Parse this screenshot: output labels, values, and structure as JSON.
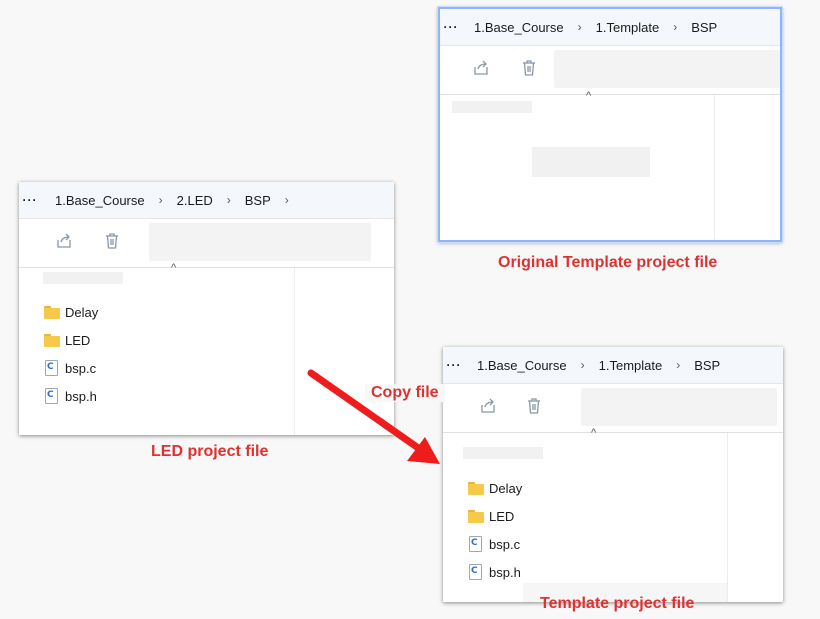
{
  "windows": {
    "original": {
      "path": [
        "1.Base_Course",
        "1.Template",
        "BSP"
      ],
      "items": []
    },
    "led": {
      "path": [
        "1.Base_Course",
        "2.LED",
        "BSP"
      ],
      "items": [
        {
          "name": "Delay",
          "kind": "folder"
        },
        {
          "name": "LED",
          "kind": "folder"
        },
        {
          "name": "bsp.c",
          "kind": "c-file"
        },
        {
          "name": "bsp.h",
          "kind": "c-file"
        }
      ]
    },
    "template": {
      "path": [
        "1.Base_Course",
        "1.Template",
        "BSP"
      ],
      "items": [
        {
          "name": "Delay",
          "kind": "folder"
        },
        {
          "name": "LED",
          "kind": "folder"
        },
        {
          "name": "bsp.c",
          "kind": "c-file"
        },
        {
          "name": "bsp.h",
          "kind": "c-file"
        }
      ]
    }
  },
  "labels": {
    "original": "Original Template project file",
    "led": "LED project file",
    "template": "Template project file",
    "copy": "Copy file"
  },
  "icons": {
    "more": "more-dots-icon",
    "chevron": "chevron-right-icon",
    "share": "share-icon",
    "delete": "trash-icon",
    "folder": "folder-icon",
    "c_file": "c-file-icon"
  },
  "colors": {
    "annotation": "#e03131",
    "arrow": "#ee1c1c",
    "active_border": "#8db4ff",
    "folder": "#f7c948"
  }
}
